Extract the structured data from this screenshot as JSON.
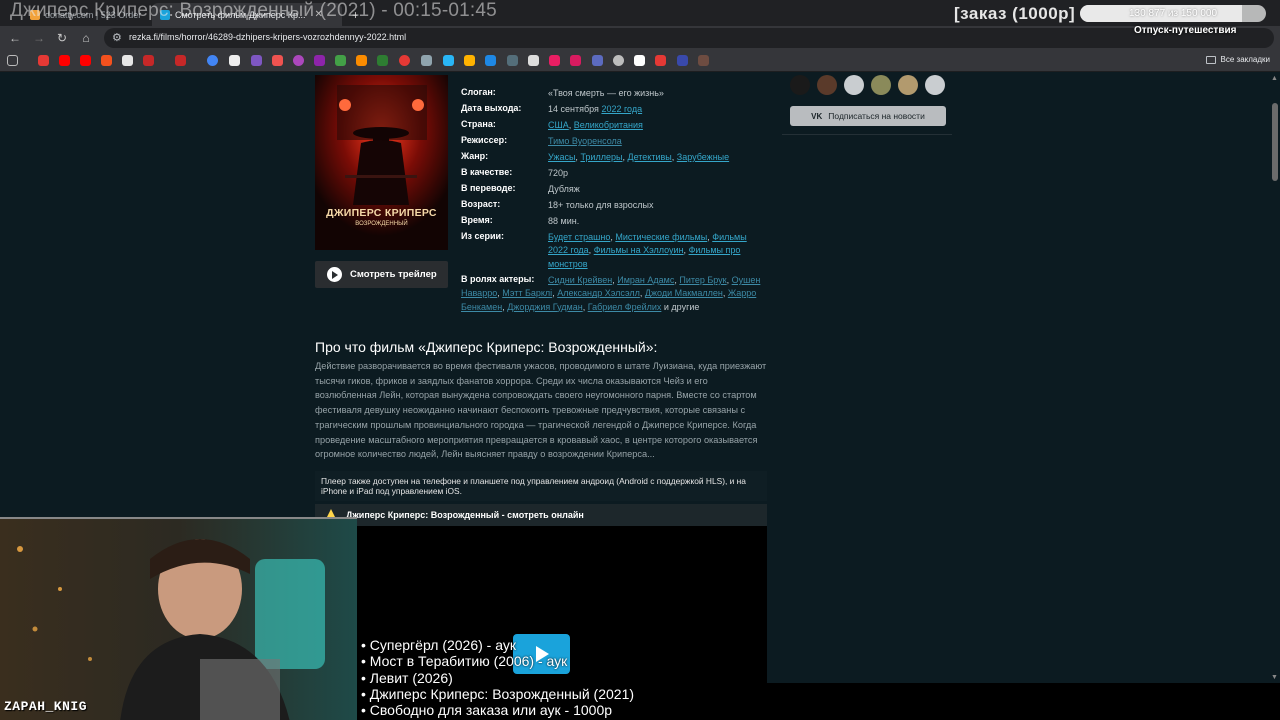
{
  "overlay_title": "Джиперс Криперс: Возрожденный (2021) - 00:15-01:45",
  "tabs": [
    {
      "label": "donatty.com | 523 Order"
    },
    {
      "label": "Смотреть фильм Джиперс Кр..."
    }
  ],
  "browser": {
    "url": "rezka.fi/films/horror/46289-dzhipers-kripers-vozrozhdennyy-2022.html",
    "all_bookmarks": "Все закладки"
  },
  "stream": {
    "order_badge": "[заказ (1000р]",
    "progress_text": "130 877 из 150 000",
    "progress_fraction": 0.8725,
    "progress_caption": "Отпуск-путешествия"
  },
  "film": {
    "trailer_label": "Смотреть трейлер",
    "slogan_label": "Слоган:",
    "slogan": "«Твоя смерть — его жизнь»",
    "release_label": "Дата выхода:",
    "release_day": "14 сентября",
    "release_year": "2022 года",
    "country_label": "Страна:",
    "country_1": "США",
    "country_2": "Великобритания",
    "director_label": "Режиссер:",
    "director": "Тимо Вуоренсола",
    "genre_label": "Жанр:",
    "genres": [
      "Ужасы",
      "Триллеры",
      "Детективы",
      "Зарубежные"
    ],
    "quality_label": "В качестве:",
    "quality": "720p",
    "translation_label": "В переводе:",
    "translation": "Дубляж",
    "age_label": "Возраст:",
    "age": "18+ только для взрослых",
    "duration_label": "Время:",
    "duration": "88 мин.",
    "series_label": "Из серии:",
    "series": [
      "Будет страшно",
      "Мистические фильмы",
      "Фильмы 2022 года",
      "Фильмы на Хэллоуин",
      "Фильмы про монстров"
    ],
    "cast_label": "В ролях актеры:",
    "cast": [
      "Сидни Крейвен",
      "Имран Адамс",
      "Питер Брук",
      "Оушен Наварро",
      "Мэтт Барклі",
      "Александр Хэлсэлл",
      "Джоди Макмаллен",
      "Жарро Бенкамен",
      "Джорджия Гудман",
      "Габриел Фрейлих"
    ],
    "cast_more": "и другие",
    "poster_title": "ДЖИПЕРС КРИПЕРС",
    "poster_subtitle": "ВОЗРОЖДЕННЫЙ"
  },
  "sidebar": {
    "subscribe_label": "Подписаться на новости",
    "vk_label": "VK"
  },
  "description": {
    "title": "Про что фильм «Джиперс Криперс: Возрожденный»:",
    "text": "Действие разворачивается во время фестиваля ужасов, проводимого в штате Луизиана, куда приезжают тысячи гиков, фриков и заядлых фанатов хоррора. Среди их числа оказываются Чейз и его возлюбленная Лейн, которая вынуждена сопровождать своего неугомонного парня. Вместе со стартом фестиваля девушку неожиданно начинают беспокоить тревожные предчувствия, которые связаны с трагическим прошлым провинциального городка — трагической легендой о Джиперсе Криперсе. Когда проведение масштабного мероприятия превращается в кровавый хаос, в центре которого оказывается огромное количество людей, Лейн выясняет правду о возрождении Криперса..."
  },
  "player": {
    "note": "Плеер также доступен на телефоне и планшете под управлением андроид (Android с поддержкой HLS), и на iPhone и iPad под управлением iOS.",
    "header": "Джиперс Криперс: Возрожденный - смотреть онлайн"
  },
  "queue": [
    "• Супергёрл (2026) - аук",
    "• Мост в Терабитию (2006) - аук",
    "• Левит (2026)",
    "• Джиперс Криперс: Возрожденный (2021)",
    "• Свободно для заказа или аук - 1000р"
  ],
  "streamer": "ZAPAH_KNIG"
}
